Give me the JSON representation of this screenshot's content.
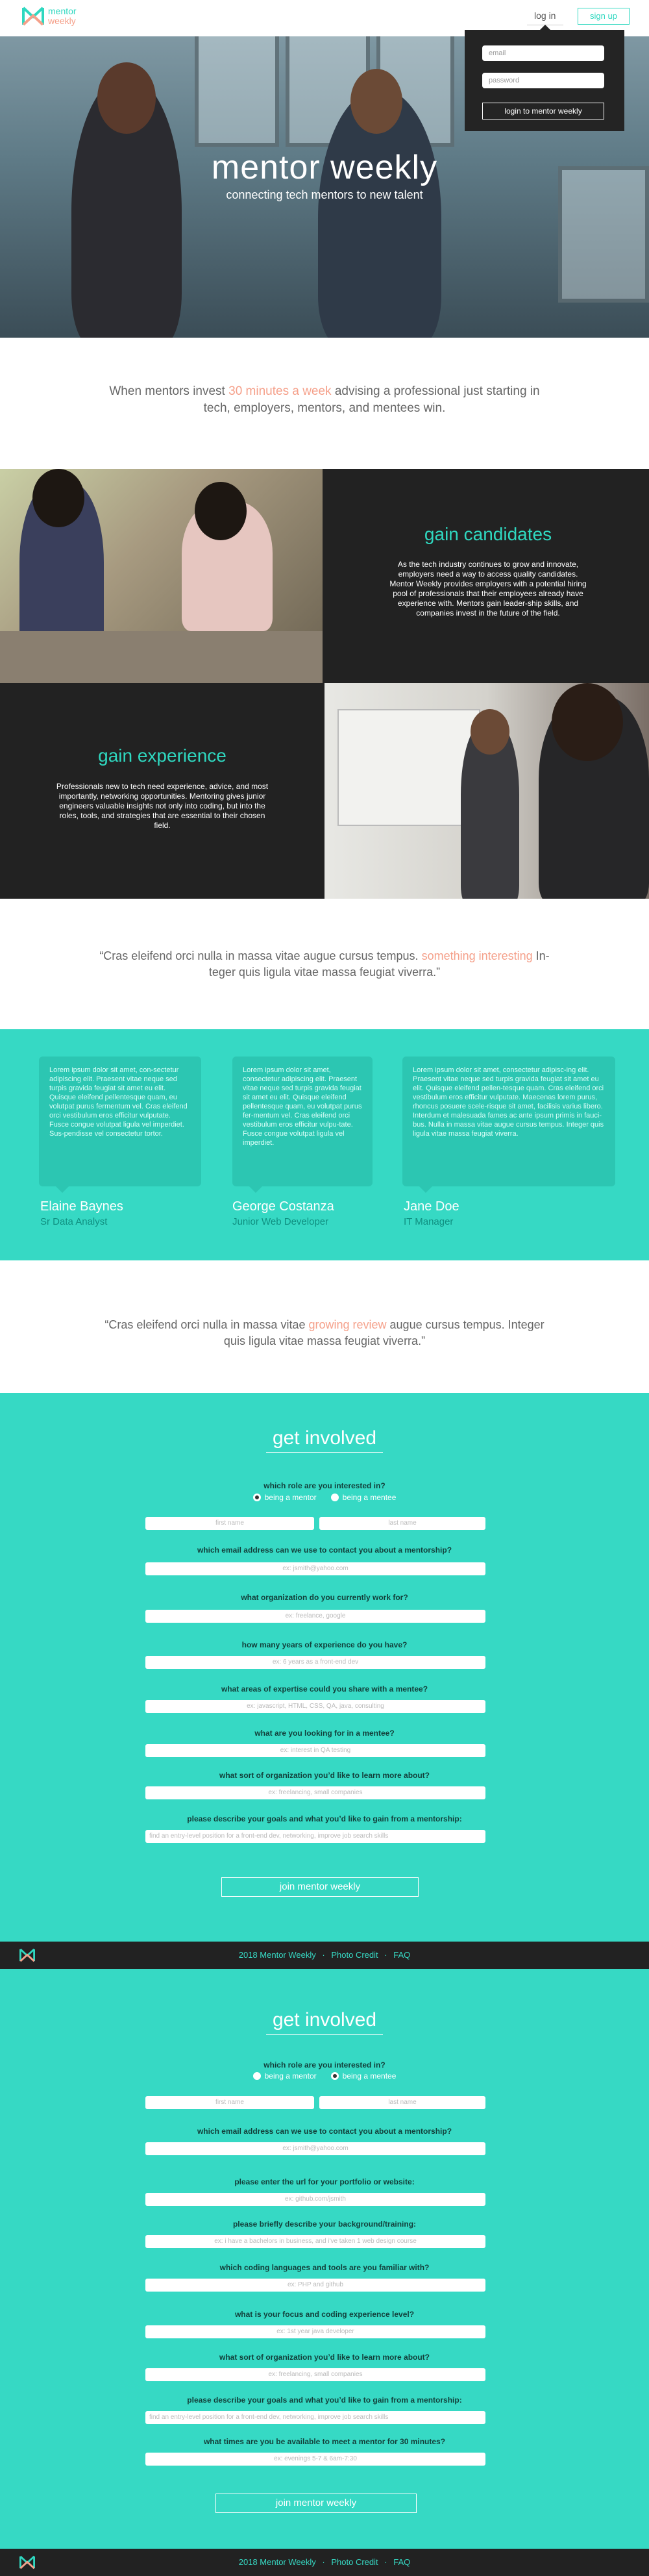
{
  "brand": {
    "name_line1": "mentor",
    "name_line2": "weekly"
  },
  "nav": {
    "login_label": "log in",
    "signup_label": "sign up"
  },
  "login_dropdown": {
    "email_placeholder": "email",
    "password_placeholder": "password",
    "submit_label": "login to mentor weekly"
  },
  "hero": {
    "title": "mentor weekly",
    "subtitle": "connecting tech mentors to new talent"
  },
  "intro": {
    "before": "When mentors invest ",
    "highlight": "30 minutes a week",
    "after": " advising a professional just starting in tech, employers, mentors, and mentees win."
  },
  "candidates": {
    "title": "gain candidates",
    "body": "As the tech industry continues to grow and innovate, employers need a way to access quality candidates. Mentor Weekly provides employers with a potential hiring pool of professionals that their employees already have experience with. Mentors gain leader-ship skills, and companies invest in the future of the field."
  },
  "experience": {
    "title": "gain experience",
    "body": "Professionals new to tech need experience, advice, and most importantly, networking opportunities. Mentoring gives junior engineers valuable insights not only into coding, but into the roles, tools, and strategies that are essential to their chosen field."
  },
  "quote1": {
    "before": "“Cras eleifend orci nulla in massa vitae augue cursus tempus. ",
    "highlight": "something interesting",
    "after": " In-teger quis ligula vitae massa feugiat viverra.”"
  },
  "testimonials": [
    {
      "text": "Lorem ipsum dolor sit amet, con-sectetur adipiscing elit. Praesent vitae neque sed turpis gravida feugiat sit amet eu elit. Quisque eleifend pellentesque quam, eu volutpat purus fermentum vel. Cras eleifend orci vestibulum eros efficitur vulputate. Fusce congue volutpat ligula vel imperdiet. Sus-pendisse vel consectetur tortor.",
      "name": "Elaine Baynes",
      "role": "Sr Data Analyst"
    },
    {
      "text": "Lorem ipsum dolor sit amet, consectetur adipiscing elit. Praesent vitae neque sed turpis gravida feugiat sit amet eu elit. Quisque eleifend pellentesque quam, eu volutpat purus fer-mentum vel. Cras eleifend orci vestibulum eros efficitur vulpu-tate. Fusce congue volutpat ligula vel imperdiet.",
      "name": "George Costanza",
      "role": "Junior Web Developer"
    },
    {
      "text": "Lorem ipsum dolor sit amet, consectetur adipisc-ing elit. Praesent vitae neque sed turpis gravida feugiat sit amet eu elit. Quisque eleifend pellen-tesque quam. Cras eleifend orci vestibulum eros efficitur vulputate. Maecenas lorem purus, rhoncus posuere scele-risque sit amet, facilisis varius libero. Interdum et malesuada fames ac ante ipsum primis in fauci-bus. Nulla in massa vitae augue cursus tempus. Integer quis ligula vitae massa feugiat viverra.",
      "name": "Jane Doe",
      "role": "IT Manager"
    }
  ],
  "quote2": {
    "before": "“Cras eleifend orci nulla in massa vitae ",
    "highlight": "growing review",
    "after": " augue cursus tempus. Integer quis ligula vitae massa feugiat viverra.”"
  },
  "form1": {
    "title": "get involved",
    "role_question": "which role are you interested in?",
    "role_mentor": "being a mentor",
    "role_mentee": "being a mentee",
    "first_name": "first name",
    "last_name": "last name",
    "q_email": "which email address can we use to contact you about a mentorship?",
    "p_email": "ex: jsmith@yahoo.com",
    "q_org": "what organization do you currently work for?",
    "p_org": "ex: freelance, google",
    "q_years": "how many years of experience do you have?",
    "p_years": "ex: 6 years as a front-end dev",
    "q_expertise": "what areas of expertise could you share with a mentee?",
    "p_expertise": "ex: javascript, HTML, CSS, QA, java, consulting",
    "q_looking": "what are you looking for in a mentee?",
    "p_looking": "ex: interest in QA testing",
    "q_orgtype": "what sort of organization you’d like to learn more about?",
    "p_orgtype": "ex: freelancing, small companies",
    "q_goals": "please describe your goals and what you’d like to gain from a mentorship:",
    "p_goals": "find an entry-level position for a front-end dev, networking, improve job search skills",
    "submit": "join mentor weekly"
  },
  "footer": {
    "year_text": "2018 Mentor Weekly",
    "photo_credit": "Photo Credit",
    "faq": "FAQ",
    "sep": "·"
  },
  "form2": {
    "title": "get involved",
    "role_question": "which role are you interested in?",
    "role_mentor": "being a mentor",
    "role_mentee": "being a mentee",
    "first_name": "first name",
    "last_name": "last name",
    "q_email": "which email address can we use to contact you about a mentorship?",
    "p_email": "ex: jsmith@yahoo.com",
    "q_url": "please enter the url for your portfolio or website:",
    "p_url": "ex: github.com/jsmith",
    "q_background": "please briefly describe your background/training:",
    "p_background": "ex: i have a bachelors in business, and i've taken 1 web design course",
    "q_languages": "which coding languages and tools are you familiar with?",
    "p_languages": "ex: PHP and github",
    "q_focus": "what is your focus and coding experience level?",
    "p_focus": "ex: 1st year java developer",
    "q_orgtype": "what sort of organization you’d like to learn more about?",
    "p_orgtype": "ex: freelancing, small companies",
    "q_goals": "please describe your goals and what you’d like to gain from a mentorship:",
    "p_goals": "find an entry-level position for a front-end dev, networking, improve job search skills",
    "q_times": "what times are you be available to meet a mentor for 30 minutes?",
    "p_times": "ex: evenings 5-7 & 6am-7:30",
    "submit": "join mentor weekly"
  },
  "colors": {
    "teal": "#36d9c4",
    "coral": "#f5a08a",
    "dark": "#222222"
  },
  "icons": {
    "logo": "mw-logo-icon"
  }
}
